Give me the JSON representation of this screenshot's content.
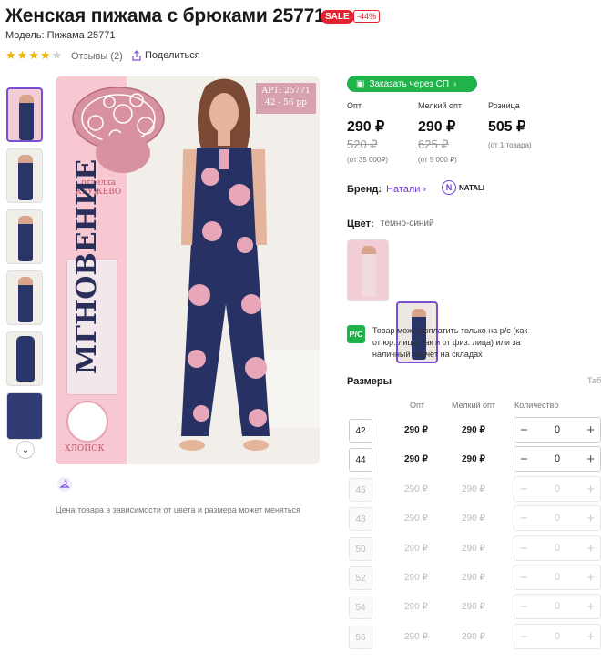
{
  "product": {
    "title": "Женская пижама с брюками 25771",
    "sale_badge": "SALE",
    "discount_badge": "-44%",
    "model": "Модель: Пижама 25771",
    "rating": 4,
    "rating_max": 5,
    "reviews": "Отзывы (2)",
    "share": "Поделиться"
  },
  "gallery": {
    "thumbnails": [
      "main-photo",
      "photo-2",
      "photo-3",
      "photo-4",
      "photo-5",
      "fabric-closeup"
    ],
    "active_index": 0,
    "main_image": {
      "art_line1": "АРТ:  25771",
      "art_line2": "42 - 56 рр",
      "trim_line1": "отделка",
      "trim_line2": "КРУЖЕВО",
      "collection_vertical": "МГНОВЕНИЕ",
      "cotton_label": "ХЛОПОК"
    },
    "price_note": "Цена товара в зависимости от цвета и размера может меняться"
  },
  "order_button": "Заказать через СП",
  "prices": [
    {
      "label": "Опт",
      "current": "290 ₽",
      "old": "520 ₽",
      "sub": "(от 35 000₽)"
    },
    {
      "label": "Мелкий опт",
      "current": "290 ₽",
      "old": "625 ₽",
      "sub": "(от 5 000 ₽)"
    },
    {
      "label": "Розница",
      "current": "505 ₽",
      "old": "",
      "sub": "(от 1 товара)"
    }
  ],
  "brand": {
    "label": "Бренд:",
    "name": "Натали",
    "logo_text": "NATALI"
  },
  "color": {
    "label": "Цвет:",
    "value": "темно-синий"
  },
  "payment": {
    "icon_text": "Р/С",
    "text": "Товар можно оплатить только на р/с (как от юр. лица, так и от физ. лица) или за наличный расчёт на складах"
  },
  "sizes": {
    "label": "Размеры",
    "table_link": "Таб",
    "headers": [
      "Опт",
      "Мелкий опт",
      "Количество"
    ],
    "rows": [
      {
        "size": "42",
        "opt": "290 ₽",
        "small": "290 ₽",
        "qty": "0",
        "available": true
      },
      {
        "size": "44",
        "opt": "290 ₽",
        "small": "290 ₽",
        "qty": "0",
        "available": true
      },
      {
        "size": "46",
        "opt": "290 ₽",
        "small": "290 ₽",
        "qty": "0",
        "available": false
      },
      {
        "size": "48",
        "opt": "290 ₽",
        "small": "290 ₽",
        "qty": "0",
        "available": false
      },
      {
        "size": "50",
        "opt": "290 ₽",
        "small": "290 ₽",
        "qty": "0",
        "available": false
      },
      {
        "size": "52",
        "opt": "290 ₽",
        "small": "290 ₽",
        "qty": "0",
        "available": false
      },
      {
        "size": "54",
        "opt": "290 ₽",
        "small": "290 ₽",
        "qty": "0",
        "available": false
      },
      {
        "size": "56",
        "opt": "290 ₽",
        "small": "290 ₽",
        "qty": "0",
        "available": false
      }
    ]
  },
  "colors": {
    "accent": "#7a4fd3",
    "sale": "#e3232f",
    "green": "#21b34b",
    "star": "#f5b400"
  }
}
